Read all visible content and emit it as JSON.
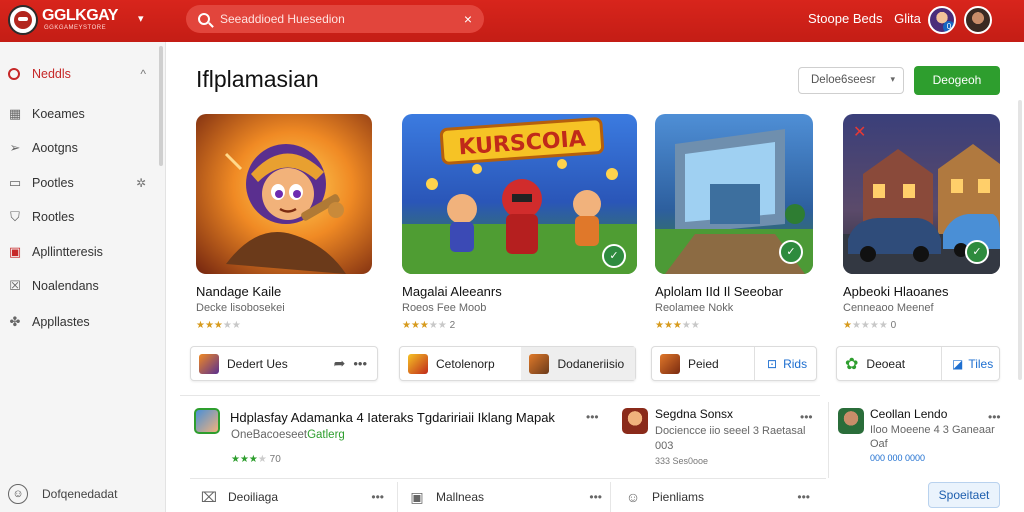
{
  "app": {
    "brand": "GGLKGAY",
    "brand_sub": "GGKGAMEYSTORE",
    "search_placeholder": "Seeaddioed Huesedion",
    "top_links": [
      "Stoope Beds",
      "Glita"
    ],
    "avatar_badge": "0"
  },
  "sidebar": {
    "items": [
      {
        "label": "Neddls",
        "icon": "circle-icon",
        "active": true,
        "trail": "^"
      },
      {
        "label": "Koeames",
        "icon": "grid-icon"
      },
      {
        "label": "Aootgns",
        "icon": "send-icon"
      },
      {
        "label": "Pootles",
        "icon": "window-icon",
        "trail": "✲"
      },
      {
        "label": "Rootles",
        "icon": "shield-icon"
      },
      {
        "label": "Apllintteresis",
        "icon": "apps-icon"
      },
      {
        "label": "Noalendans",
        "icon": "list-icon"
      },
      {
        "label": "Appllastes",
        "icon": "puzzle-icon"
      }
    ],
    "bottom_label": "Dofqenedadat"
  },
  "main": {
    "title": "Iflplamasian",
    "sort_label": "Deloe6seesr",
    "primary_button": "Deogeoh"
  },
  "cards": [
    {
      "title": "Nandage Kaile",
      "sub": "Decke lisobosekei",
      "rating": 3,
      "rating_text": ""
    },
    {
      "title": "Magalai Aleeanrs",
      "sub": "Roeos Fee Moob",
      "rating": 3,
      "rating_text": "2",
      "banner": "KURSCOIA"
    },
    {
      "title": "Aplolam IId Il Seeobar",
      "sub": "Reolamee Nokk",
      "rating": 3,
      "rating_text": ""
    },
    {
      "title": "Apbeoki Hlaoanes",
      "sub": "Cenneaoo Meenef",
      "rating": 3,
      "rating_text": "0"
    }
  ],
  "actions": [
    {
      "label": "Dedert Ues"
    },
    {
      "label": "Cetolenorp",
      "alt_label": "Dodaneriisio"
    },
    {
      "label": "Peied",
      "alt_label": "Rids"
    },
    {
      "label": "Deoeat",
      "alt_label": "Tiles"
    }
  ],
  "list": [
    {
      "title": "Hdplasfay Adamanka 4 Iateraks Tgdaririaii Iklang Mapak",
      "sub": "OneBacoeseet",
      "sub_green": "Gatlerg",
      "rating_text": "70"
    },
    {
      "title": "Segdna Sonsx",
      "sub1": "Dociencce iio seeel 3 Raetasal",
      "sub2": "003",
      "small": "333 Ses0ooe"
    },
    {
      "title": "Ceollan Lendo",
      "sub1": "Iloo Moeene 4 3 Ganeaar",
      "sub2": "Oaf",
      "small": "000 000 0000"
    }
  ],
  "bottom_tabs": [
    "Deoiliaga",
    "Mallneas",
    "Pienliams"
  ],
  "secondary_button": "Spoeitaet"
}
